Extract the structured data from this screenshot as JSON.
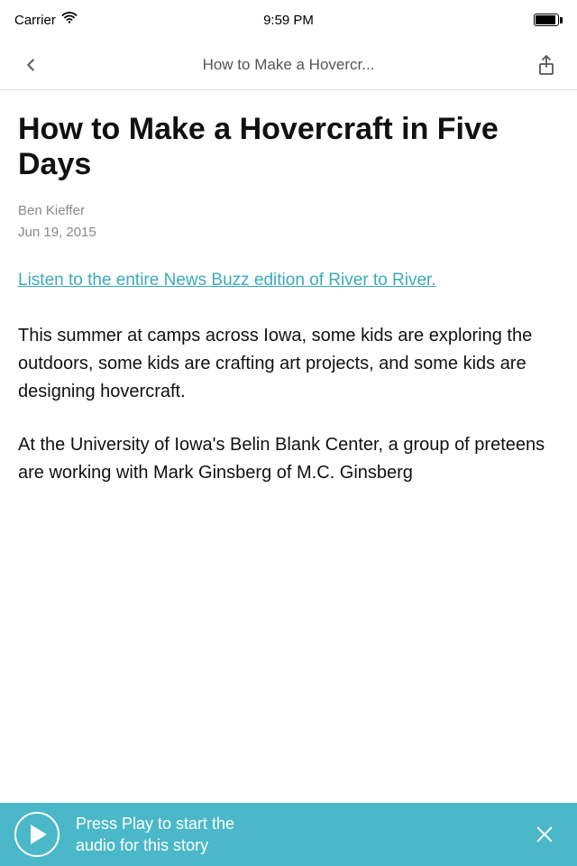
{
  "status_bar": {
    "carrier": "Carrier",
    "wifi": "wifi",
    "time": "9:59 PM",
    "battery": "full"
  },
  "nav": {
    "title": "How to Make a Hovercr...",
    "back_label": "back",
    "share_label": "share"
  },
  "article": {
    "title": "How to Make a Hovercraft in Five Days",
    "author": "Ben Kieffer",
    "date": "Jun 19, 2015",
    "link_text": "Listen to the entire News Buzz edition of River to River.",
    "body_paragraph_1": "This summer at camps across Iowa, some kids are exploring the outdoors, some kids are crafting art projects, and some kids are designing hovercraft.",
    "body_paragraph_2": "At the University of Iowa's Belin Blank Center, a group of preteens are working with Mark Ginsberg of M.C. Ginsberg"
  },
  "audio_player": {
    "text_line1": "Press Play to start the",
    "text_line2": "audio for this story",
    "play_label": "play",
    "close_label": "close"
  }
}
